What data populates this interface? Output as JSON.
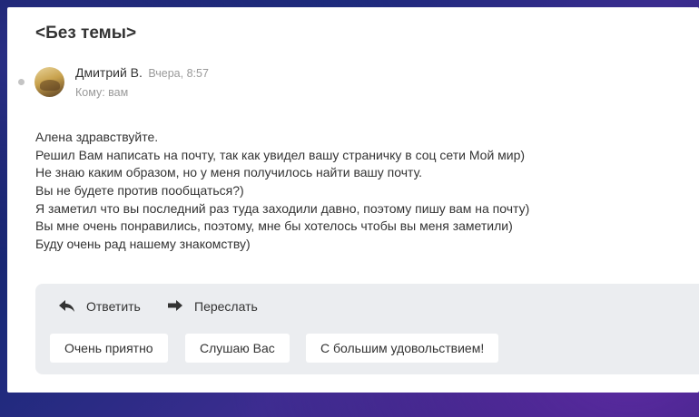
{
  "message": {
    "subject": "<Без темы>",
    "sender_name": "Дмитрий В.",
    "sent_time": "Вчера, 8:57",
    "recipient": "Кому: вам",
    "body_lines": [
      "Алена здравствуйте.",
      "Решил Вам написать на почту, так как увидел вашу страничку в соц сети Мой мир)",
      "Не знаю каким образом, но у меня получилось найти вашу почту.",
      "Вы не будете против пообщаться?)",
      "Я заметил что вы последний раз туда заходили давно, поэтому пишу вам на почту)",
      "Вы мне очень понравились, поэтому, мне бы хотелось чтобы вы меня заметили)",
      "Буду очень рад нашему знакомству)"
    ]
  },
  "actions": {
    "reply_label": "Ответить",
    "reply_icon": "reply-arrow-icon",
    "forward_label": "Переслать",
    "forward_icon": "forward-arrow-icon"
  },
  "quick_replies": [
    "Очень приятно",
    "Слушаю Вас",
    "С большим удовольствием!"
  ],
  "colors": {
    "panel_bg": "#ebedf0",
    "text": "#333333",
    "muted": "#999999"
  }
}
